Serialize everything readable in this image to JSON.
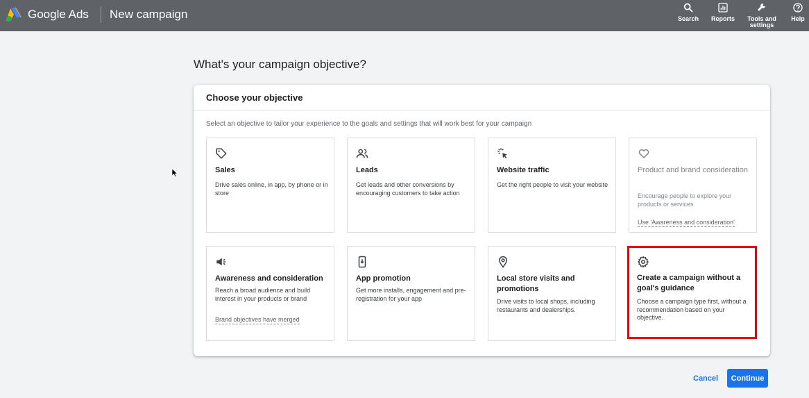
{
  "header": {
    "brand": "Google Ads",
    "page_name": "New campaign",
    "actions": [
      {
        "label": "Search",
        "icon": "search-icon"
      },
      {
        "label": "Reports",
        "icon": "reports-icon"
      },
      {
        "label": "Tools and settings",
        "icon": "wrench-icon"
      },
      {
        "label": "Help",
        "icon": "help-icon"
      }
    ]
  },
  "main": {
    "heading": "What's your campaign objective?",
    "panel_title": "Choose your objective",
    "panel_description": "Select an objective to tailor your experience to the goals and settings that will work best for your campaign",
    "cards": [
      {
        "icon": "tag-icon",
        "title": "Sales",
        "description": "Drive sales online, in app, by phone or in store"
      },
      {
        "icon": "people-icon",
        "title": "Leads",
        "description": "Get leads and other conversions by encouraging customers to take action"
      },
      {
        "icon": "click-icon",
        "title": "Website traffic",
        "description": "Get the right people to visit your website"
      },
      {
        "icon": "heart-icon",
        "title": "Product and brand consideration",
        "description": "Encourage people to explore your products or services",
        "note": "Use 'Awareness and consideration'",
        "state": "disabled"
      },
      {
        "icon": "megaphone-icon",
        "title": "Awareness and consideration",
        "description": "Reach a broad audience and build interest in your products or brand",
        "note": "Brand objectives have merged"
      },
      {
        "icon": "phone-icon",
        "title": "App promotion",
        "description": "Get more installs, engagement and pre-registration for your app"
      },
      {
        "icon": "pin-icon",
        "title": "Local store visits and promotions",
        "description": "Drive visits to local shops, including restaurants and dealerships."
      },
      {
        "icon": "gear-icon",
        "title": "Create a campaign without a goal's guidance",
        "description": "Choose a campaign type first, without a recommendation based on your objective.",
        "state": "highlighted"
      }
    ]
  },
  "footer": {
    "cancel_label": "Cancel",
    "continue_label": "Continue"
  },
  "colors": {
    "topbar": "#5f6368",
    "accent": "#1a73e8",
    "highlight_border": "#e8000d"
  }
}
